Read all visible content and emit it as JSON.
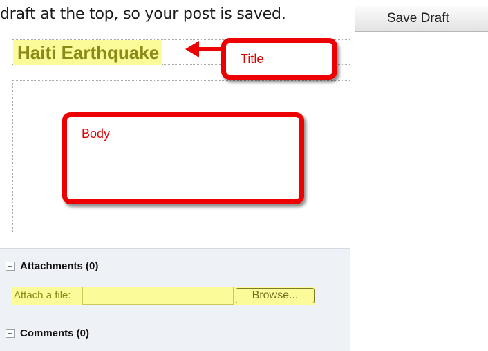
{
  "instruction": {
    "text": "draft at the top, so your post is saved."
  },
  "toolbar": {
    "save_draft_label": "Save Draft"
  },
  "post": {
    "title": "Haiti Earthquake"
  },
  "annotations": {
    "title_callout": "Title",
    "body_callout": "Body"
  },
  "attachments": {
    "header": "Attachments (0)",
    "attach_label": "Attach a file:",
    "file_value": "",
    "browse_label": "Browse..."
  },
  "comments": {
    "header": "Comments (0)"
  },
  "colors": {
    "highlight": "#fbfb9a",
    "callout_red": "#ee0000",
    "panel_bg": "#eef1f5"
  },
  "icons": [
    "collapse-icon",
    "expand-icon",
    "arrow-icon"
  ]
}
